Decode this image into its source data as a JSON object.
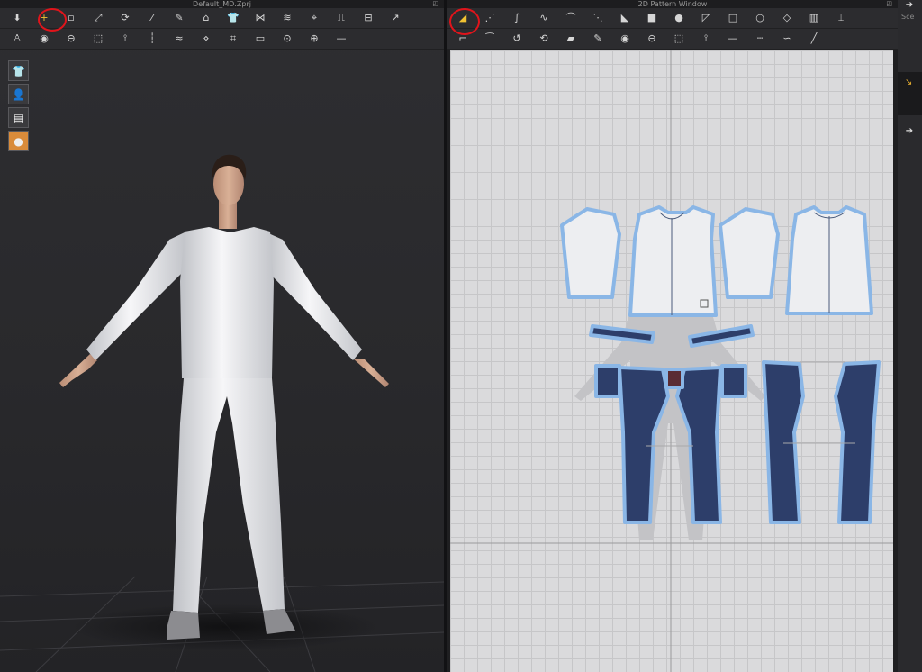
{
  "left_window": {
    "title": "Default_MD.Zprj",
    "row1_icons": [
      "arrow-down-icon",
      "add-point-icon",
      "select-box-icon",
      "transform-icon",
      "rotate-icon",
      "brush-icon",
      "tack-icon",
      "tshirt-fold-icon",
      "shirt-icon",
      "tie-icon",
      "steam-icon",
      "pin-icon",
      "avatar-arrange-icon",
      "arrangement-icon",
      "cursor-tool-icon"
    ],
    "row2_icons": [
      "avatar-pose-icon",
      "button-icon",
      "buttonhole-icon",
      "select-button-icon",
      "zipper-icon",
      "topstitch-icon",
      "puckering-icon",
      "pattern-sew-icon",
      "fabric-sew-icon",
      "flatten-icon",
      "pin-circle-icon",
      "measure-icon",
      "line-icon"
    ],
    "viewport_tools": [
      "shirt-view-icon",
      "avatar-view-icon",
      "fabric-view-icon",
      "skin-view-icon"
    ],
    "highlighted_tool": "add-point-icon"
  },
  "right_window": {
    "title": "2D Pattern Window",
    "row1_icons": [
      "transform-pattern-icon",
      "edit-point-icon",
      "edit-curve-icon",
      "add-point-curve-icon",
      "curvature-icon",
      "edit-segment-icon",
      "polygon-icon",
      "rectangle-icon",
      "circle-icon",
      "internal-polygon-icon",
      "internal-rectangle-icon",
      "internal-circle-icon",
      "dart-icon",
      "pleat-icon",
      "trim-icon"
    ],
    "row2_icons": [
      "seam-allowance-icon",
      "sewing-icon",
      "free-sewing-icon",
      "segment-sewing-icon",
      "fold-icon",
      "tack-icon",
      "button-icon",
      "buttonhole-icon",
      "select-button-icon",
      "zipper-icon",
      "line-icon",
      "dashed-line-icon",
      "wave-line-icon",
      "trace-icon"
    ],
    "highlighted_tool": "transform-pattern-icon"
  },
  "side_panel": {
    "label": "Sce",
    "buttons": [
      "arrow-right-icon",
      "arrow-right-icon"
    ]
  },
  "colors": {
    "highlight_circle": "#e0141b",
    "pattern_outline": "#8ab6e6",
    "shirt_fabric": "#ecedf0",
    "denim": "#2d3e6a",
    "grid_bg": "#dadadc"
  }
}
